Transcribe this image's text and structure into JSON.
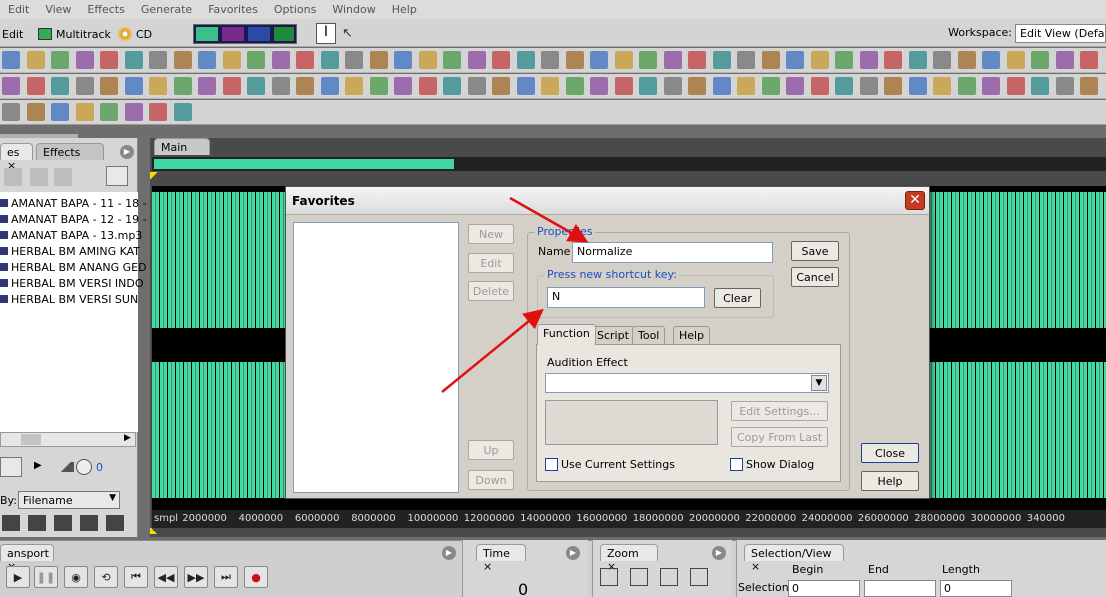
{
  "menu": [
    "Edit",
    "View",
    "Effects",
    "Generate",
    "Favorites",
    "Options",
    "Window",
    "Help"
  ],
  "modes": {
    "edit": "Edit",
    "multitrack": "Multitrack",
    "cd": "CD"
  },
  "workspace": {
    "label": "Workspace:",
    "value": "Edit View (Default"
  },
  "left_panel": {
    "tabs": [
      "es",
      "Effects"
    ],
    "files": [
      "AMANAT BAPA - 11 - 18 -",
      "AMANAT BAPA - 12 - 19 -",
      "AMANAT BAPA - 13.mp3",
      "HERBAL BM AMING KAT",
      "HERBAL BM ANANG GED",
      "HERBAL BM VERSI INDO",
      "HERBAL BM VERSI SUN"
    ],
    "zoom_value": "0",
    "sort_label": "By:",
    "sort_value": "Filename"
  },
  "main_tab": "Main",
  "ruler": [
    "smpl",
    "2000000",
    "4000000",
    "6000000",
    "8000000",
    "10000000",
    "12000000",
    "14000000",
    "16000000",
    "18000000",
    "20000000",
    "22000000",
    "24000000",
    "26000000",
    "28000000",
    "30000000",
    "340000"
  ],
  "bottom": {
    "transport": "ansport",
    "time": "Time",
    "time_value": "0",
    "zoom": "Zoom",
    "selection_view": "Selection/View",
    "sel_headers": [
      "Begin",
      "End",
      "Length"
    ],
    "sel_label": "Selection",
    "sel_begin": "0",
    "sel_end": "",
    "sel_length": "0"
  },
  "dialog": {
    "title": "Favorites",
    "buttons": {
      "new": "New",
      "edit": "Edit",
      "delete": "Delete",
      "up": "Up",
      "down": "Down",
      "save": "Save",
      "cancel": "Cancel",
      "clear": "Clear",
      "close": "Close",
      "help": "Help",
      "edit_settings": "Edit Settings...",
      "copy_from_last": "Copy From Last"
    },
    "properties_label": "Properties",
    "name_label": "Name",
    "name_value": "Normalize",
    "shortcut_label": "Press new shortcut key:",
    "shortcut_value": "N",
    "tabs": [
      "Function",
      "Script",
      "Tool",
      "Help"
    ],
    "audition_effect": "Audition Effect",
    "use_current": "Use Current Settings",
    "show_dialog": "Show Dialog"
  },
  "colors": {
    "waveform": "#44dba2",
    "arrow": "#e01010",
    "legend": "#1c4ec2",
    "close_btn": "#c53b22"
  }
}
